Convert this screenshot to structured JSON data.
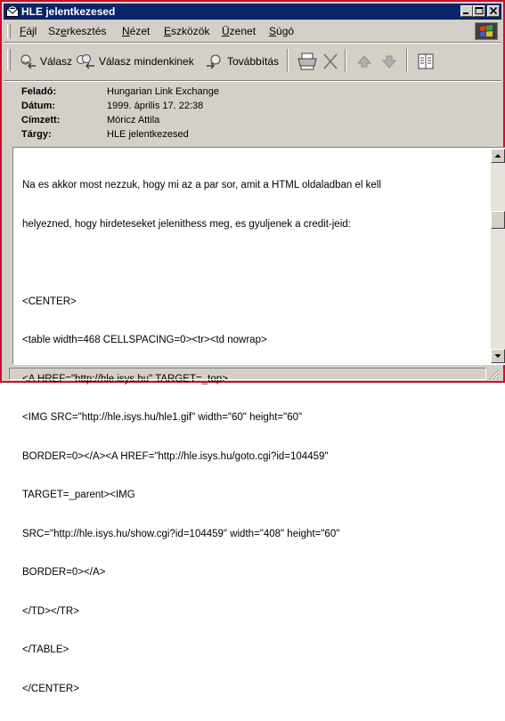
{
  "window": {
    "title": "HLE jelentkezesed"
  },
  "menu": [
    {
      "before": "",
      "key": "F",
      "after": "ájl"
    },
    {
      "before": "Sz",
      "key": "e",
      "after": "rkesztés"
    },
    {
      "before": "",
      "key": "N",
      "after": "ézet"
    },
    {
      "before": "",
      "key": "E",
      "after": "szközök"
    },
    {
      "before": "",
      "key": "Ü",
      "after": "zenet"
    },
    {
      "before": "",
      "key": "S",
      "after": "úgó"
    }
  ],
  "toolbar": {
    "reply": "Válasz",
    "reply_all": "Válasz mindenkinek",
    "forward": "Továbbítás"
  },
  "header": {
    "from_label": "Feladó:",
    "from_value": "Hungarian Link Exchange",
    "date_label": "Dátum:",
    "date_value": "1999. április 17. 22:38",
    "to_label": "Címzett:",
    "to_value": "Móricz Attila",
    "subject_label": "Tárgy:",
    "subject_value": "HLE jelentkezesed"
  },
  "body": {
    "lines": [
      "Na es akkor most nezzuk, hogy mi az a par sor, amit a HTML oldaladban el kell",
      "helyezned, hogy hirdeteseket jelenithess meg, es gyuljenek a credit-jeid:",
      "",
      "<CENTER>",
      "<table width=468 CELLSPACING=0><tr><td nowrap>",
      "<A HREF=\"http://hle.isys.hu\" TARGET=_top>",
      "<IMG SRC=\"http://hle.isys.hu/hle1.gif\" width=\"60\" height=\"60\"",
      "BORDER=0></A><A HREF=\"http://hle.isys.hu/goto.cgi?id=104459\"",
      "TARGET=_parent><IMG",
      "SRC=\"http://hle.isys.hu/show.cgi?id=104459\" width=\"408\" height=\"60\"",
      "BORDER=0></A>",
      "</TD></TR>",
      "</TABLE>",
      "</CENTER>"
    ]
  }
}
